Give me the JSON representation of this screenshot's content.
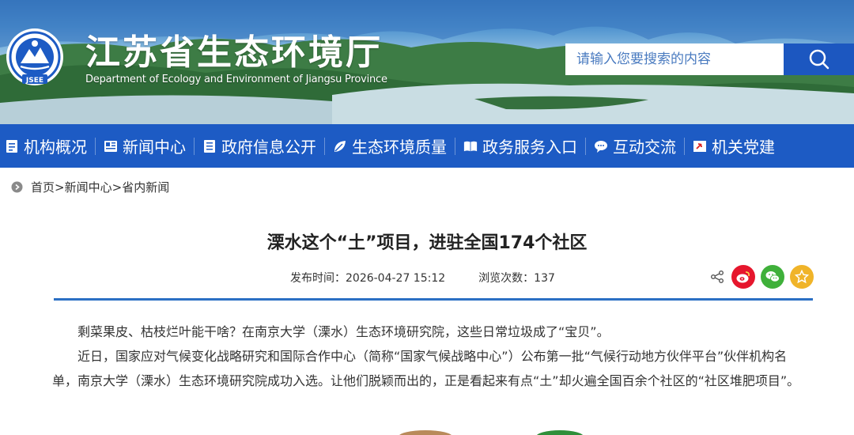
{
  "header": {
    "title_cn": "江苏省生态环境厅",
    "title_en": "Department of Ecology and Environment of Jiangsu Province",
    "logo_text": "JSEE",
    "search": {
      "placeholder": "请输入您要搜索的内容",
      "button_icon": "search-icon"
    }
  },
  "nav": {
    "items": [
      {
        "label": "机构概况",
        "icon": "document-icon"
      },
      {
        "label": "新闻中心",
        "icon": "newspaper-icon"
      },
      {
        "label": "政府信息公开",
        "icon": "file-list-icon"
      },
      {
        "label": "生态环境质量",
        "icon": "leaf-icon"
      },
      {
        "label": "政务服务入口",
        "icon": "book-open-icon"
      },
      {
        "label": "互动交流",
        "icon": "chat-icon"
      },
      {
        "label": "机关党建",
        "icon": "party-flag-icon"
      }
    ],
    "bg_color": "#1d5bc4"
  },
  "breadcrumb": {
    "home": "首页",
    "level1": "新闻中心",
    "level2": "省内新闻",
    "sep": ">"
  },
  "article": {
    "title": "溧水这个“土”项目，进驻全国174个社区",
    "publish_label": "发布时间：",
    "publish_time": "2026-04-27 15:12",
    "views_label": "浏览次数：",
    "views": "137",
    "paragraphs": [
      "剩菜果皮、枯枝烂叶能干啥？在南京大学（溧水）生态环境研究院，这些日常垃圾成了“宝贝”。",
      "近日，国家应对气候变化战略研究和国际合作中心（简称“国家气候战略中心”）公布第一批“气候行动地方伙伴平台”伙伴机构名单，南京大学（溧水）生态环境研究院成功入选。让他们脱颖而出的，正是看起来有点“土”却火遍全国百余个社区的“社区堆肥项目”。"
    ]
  },
  "share": {
    "icons": [
      "share-icon",
      "weibo-icon",
      "wechat-icon",
      "favorite-icon"
    ],
    "colors": {
      "weibo": "#e6162d",
      "wechat": "#3fb03a",
      "favorite": "#f0b429"
    }
  },
  "accent_color": "#2b6fc4"
}
